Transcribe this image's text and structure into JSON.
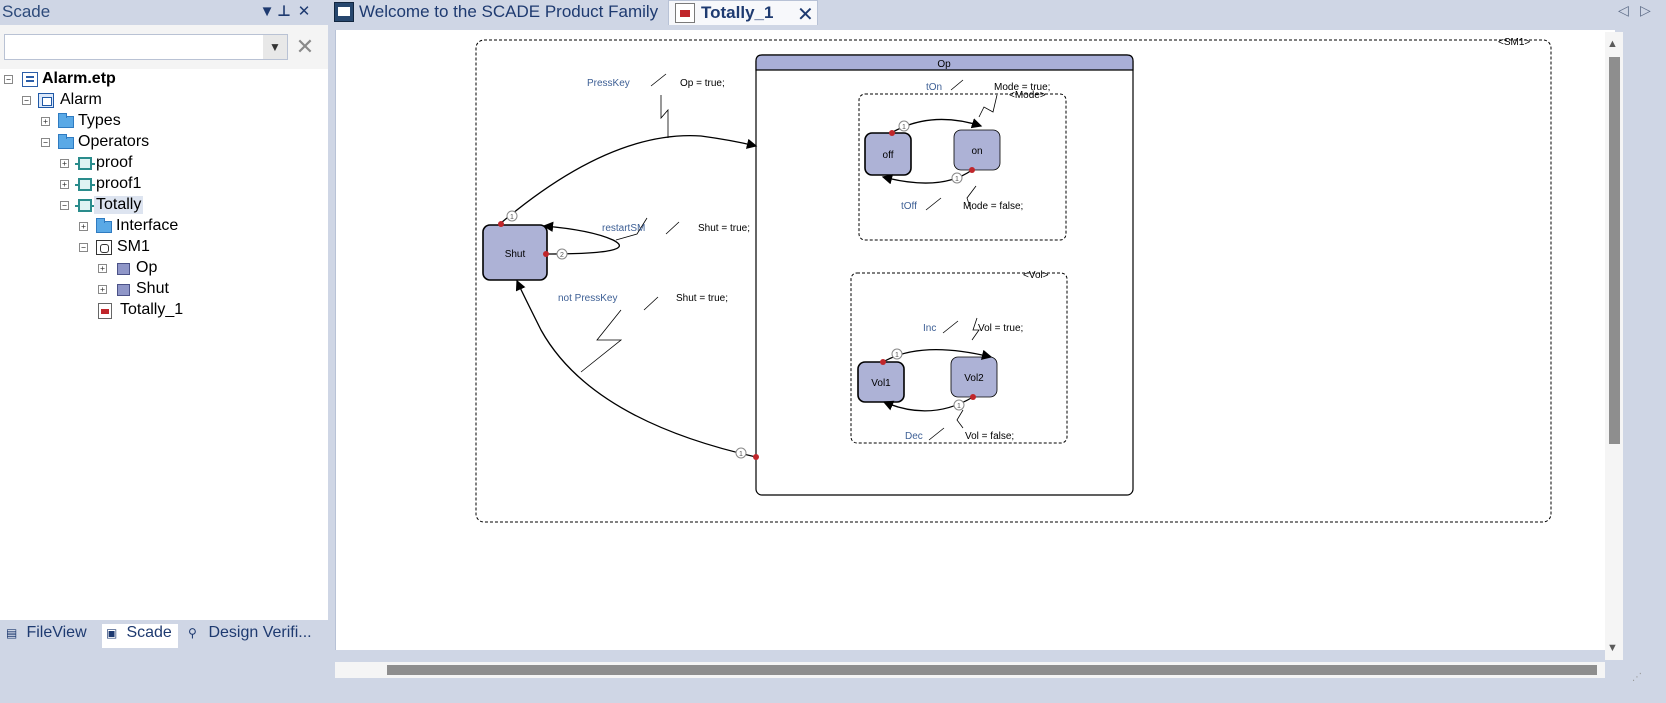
{
  "panel": {
    "title": "Scade",
    "search_value": "",
    "tree": [
      {
        "label": "Alarm.etp"
      },
      {
        "label": "Alarm"
      },
      {
        "label": "Types"
      },
      {
        "label": "Operators"
      },
      {
        "label": "proof"
      },
      {
        "label": "proof1"
      },
      {
        "label": "Totally"
      },
      {
        "label": "Interface"
      },
      {
        "label": "SM1"
      },
      {
        "label": "Op"
      },
      {
        "label": "Shut"
      },
      {
        "label": "Totally_1"
      }
    ],
    "bottom_tabs": [
      {
        "label": "FileView"
      },
      {
        "label": "Scade"
      },
      {
        "label": "Design Verifi..."
      }
    ]
  },
  "tabs": [
    {
      "label": "Welcome to the SCADE Product Family"
    },
    {
      "label": "Totally_1"
    }
  ],
  "diagram": {
    "sm1_label": "<SM1>",
    "op_title": "Op",
    "mode_label": "<Mode>",
    "vol_label": "<Vol>",
    "states": {
      "shut": "Shut",
      "off": "off",
      "on": "on",
      "vol1": "Vol1",
      "vol2": "Vol2"
    },
    "transitions": {
      "presskey": "PressKey",
      "op_true": "Op = true;",
      "restart": "restartSM",
      "shut_true_1": "Shut = true;",
      "notpress": "not PressKey",
      "shut_true_2": "Shut = true;",
      "ton": "tOn",
      "mode_true": "Mode = true;",
      "toff": "tOff",
      "mode_false": "Mode = false;",
      "inc": "Inc",
      "vol_true": "Vol = true;",
      "dec": "Dec",
      "vol_false": "Vol = false;"
    },
    "priorities": {
      "p1": "1",
      "p2": "2",
      "p3": "1",
      "p4": "1",
      "p5": "1",
      "p6": "1",
      "p7": "1"
    }
  }
}
